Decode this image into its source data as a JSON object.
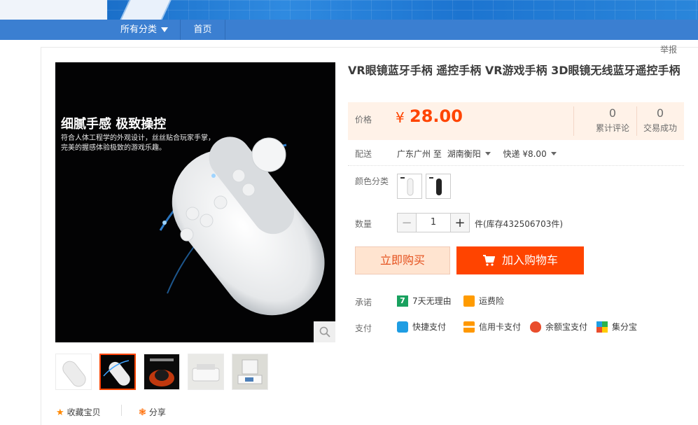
{
  "nav": {
    "category_label": "所有分类",
    "home_label": "首页"
  },
  "report_label": "举报",
  "main_image": {
    "headline": "细腻手感 极致操控",
    "subtext": "符合人体工程学的外观设计，丝丝贴合玩家手掌，完美的握感体验极致的游戏乐趣。"
  },
  "product": {
    "title": "VR眼镜蓝牙手柄 遥控手柄 VR游戏手柄 3D眼镜无线蓝牙遥控手柄",
    "price_label": "价格",
    "currency": "¥",
    "price": "28.00",
    "stats": [
      {
        "value": "0",
        "label": "累计评论"
      },
      {
        "value": "0",
        "label": "交易成功"
      }
    ],
    "shipping_label": "配送",
    "ship_from": "广东广州",
    "ship_to_prefix": "至",
    "ship_to": "湖南衡阳",
    "ship_method": "快递 ¥8.00",
    "color_label": "颜色分类",
    "quantity_label": "数量",
    "quantity_value": "1",
    "stock_text": "件(库存432506703件)",
    "buy_now_label": "立即购买",
    "add_cart_label": "加入购物车",
    "promise_label": "承诺",
    "promises": [
      "7天无理由",
      "运费险"
    ],
    "pay_label": "支付",
    "payments": [
      "快捷支付",
      "信用卡支付",
      "余额宝支付",
      "集分宝"
    ]
  },
  "actions": {
    "favorite_label": "收藏宝贝",
    "share_label": "分享"
  },
  "colors": {
    "accent": "#ff4400",
    "nav": "#3b7fd1",
    "price_bg": "#fff2e8"
  }
}
